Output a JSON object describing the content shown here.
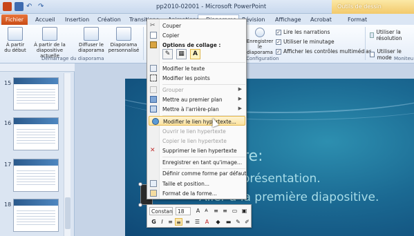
{
  "window": {
    "title": "pp2010-02001 - Microsoft PowerPoint",
    "context_tab_group": "Outils de dessin"
  },
  "tabs": [
    "Fichier",
    "Accueil",
    "Insertion",
    "Création",
    "Transitions",
    "Animations",
    "Diaporama",
    "Révision",
    "Affichage",
    "Acrobat",
    "Format"
  ],
  "ribbon": {
    "buttons": [
      {
        "label": "À partir du début"
      },
      {
        "label": "À partir de la diapositive actuelle"
      },
      {
        "label": "Diffuser le diaporama"
      },
      {
        "label": "Diaporama personnalisé"
      }
    ],
    "group_demarrage": "Démarrage du diaporama",
    "group_configuration": "Configuration",
    "group_moniteurs": "Moniteu",
    "enregistrer": "Enregistrer le diaporama",
    "checks": [
      {
        "label": "Lire les narrations",
        "checked": true
      },
      {
        "label": "Utiliser le minutage",
        "checked": true
      },
      {
        "label": "Afficher les contrôles multimédias",
        "checked": true
      }
    ],
    "right_checks": [
      {
        "label": "Utiliser la résolution"
      },
      {
        "label": "Utiliser le mode"
      }
    ]
  },
  "slides_pane": {
    "slide_numbers": [
      "15",
      "16",
      "17",
      "18"
    ]
  },
  "slide": {
    "title": "re:",
    "bullet1": "ne présentation.",
    "bullet2": "Aller à la première diapositive."
  },
  "context_menu": {
    "items": [
      {
        "label": "Couper",
        "icon": "scissors-icon",
        "enabled": true
      },
      {
        "label": "Copier",
        "icon": "copy-icon",
        "enabled": true
      },
      {
        "label": "Options de collage :",
        "icon": "clipboard-icon",
        "enabled": true,
        "bold": true
      },
      {
        "label": "Modifier le texte",
        "icon": "edit-text-icon",
        "enabled": true
      },
      {
        "label": "Modifier les points",
        "icon": "edit-points-icon",
        "enabled": true
      },
      {
        "label": "Grouper",
        "icon": "group-icon",
        "enabled": false,
        "submenu": true
      },
      {
        "label": "Mettre au premier plan",
        "icon": "bring-front-icon",
        "enabled": true,
        "submenu": true
      },
      {
        "label": "Mettre à l'arrière-plan",
        "icon": "send-back-icon",
        "enabled": true,
        "submenu": true
      },
      {
        "label": "Modifier le lien hypertexte...",
        "icon": "hyperlink-icon",
        "enabled": true,
        "highlighted": true
      },
      {
        "label": "Ouvrir le lien hypertexte",
        "icon": "",
        "enabled": false
      },
      {
        "label": "Copier le lien hypertexte",
        "icon": "",
        "enabled": false
      },
      {
        "label": "Supprimer le lien hypertexte",
        "icon": "remove-link-icon",
        "enabled": true
      },
      {
        "label": "Enregistrer en tant qu'image...",
        "icon": "",
        "enabled": true
      },
      {
        "label": "Définir comme forme par défaut",
        "icon": "",
        "enabled": true
      },
      {
        "label": "Taille et position...",
        "icon": "size-icon",
        "enabled": true
      },
      {
        "label": "Format de la forme...",
        "icon": "format-shape-icon",
        "enabled": true
      }
    ]
  },
  "mini_toolbar": {
    "font": "Constan",
    "size": "18"
  }
}
